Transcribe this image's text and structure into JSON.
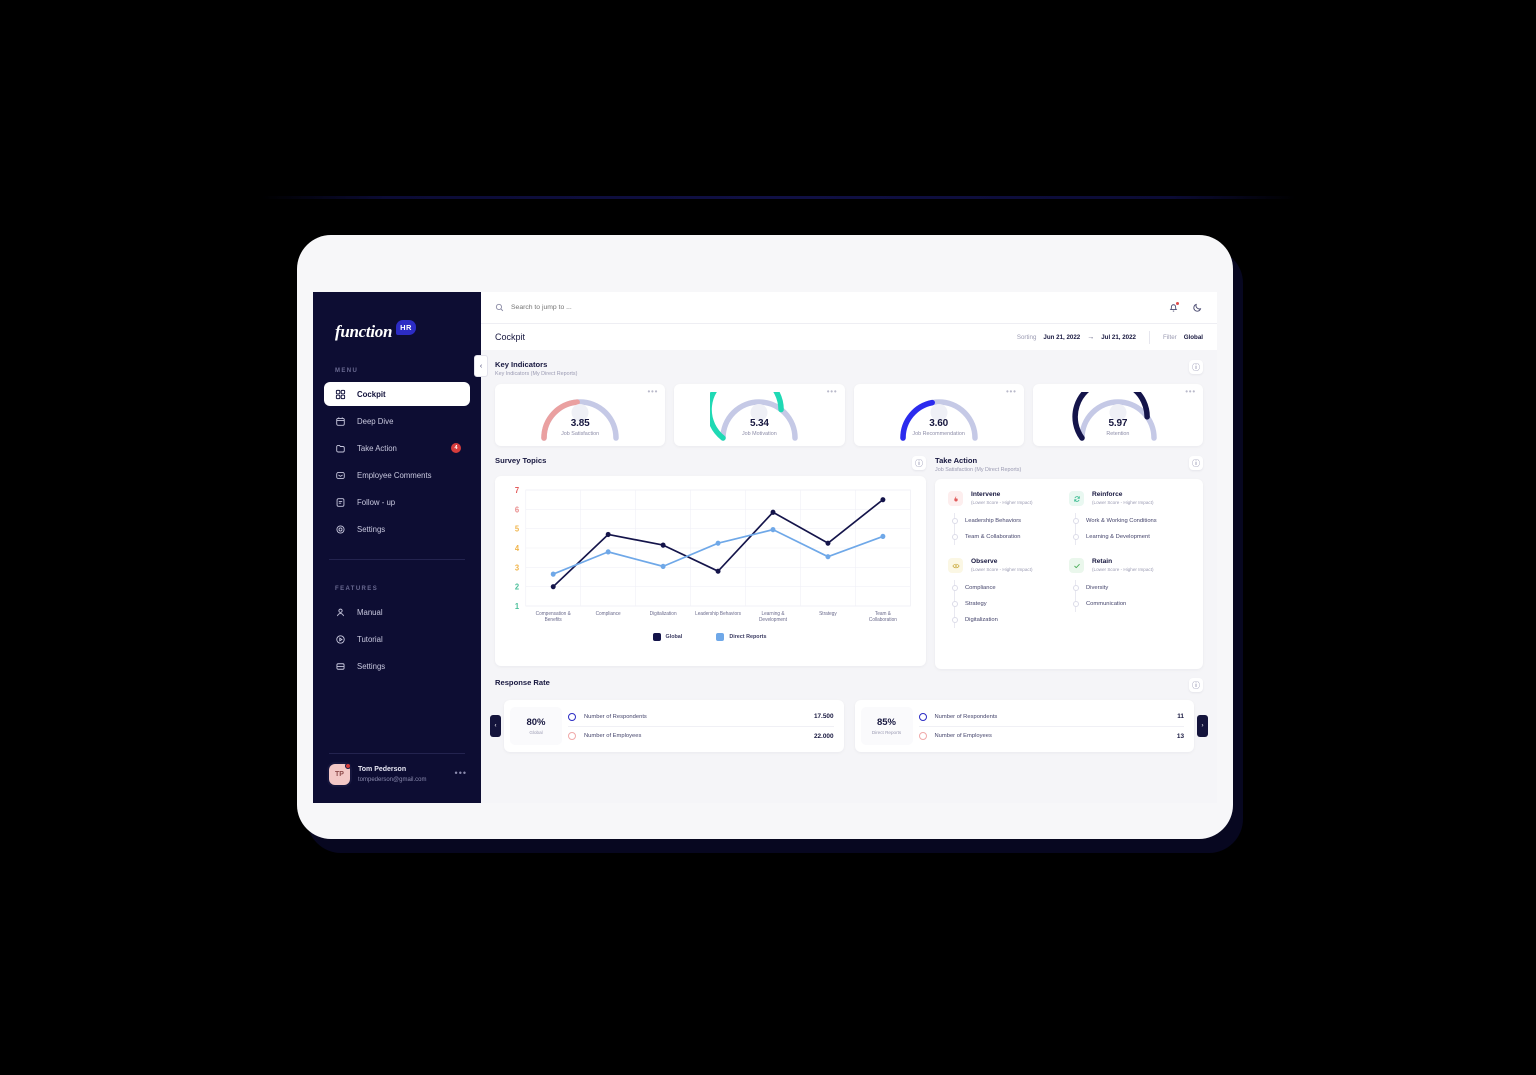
{
  "brand": {
    "name": "function",
    "badge": "HR"
  },
  "sidebar": {
    "menu_label": "MENU",
    "features_label": "FEATURES",
    "menu_items": [
      {
        "label": "Cockpit",
        "icon": "grid-icon",
        "active": true,
        "badge": ""
      },
      {
        "label": "Deep Dive",
        "icon": "calendar-icon",
        "active": false,
        "badge": ""
      },
      {
        "label": "Take Action",
        "icon": "folder-icon",
        "active": false,
        "badge": "4"
      },
      {
        "label": "Employee Comments",
        "icon": "message-icon",
        "active": false,
        "badge": ""
      },
      {
        "label": "Follow - up",
        "icon": "clipboard-icon",
        "active": false,
        "badge": ""
      },
      {
        "label": "Settings",
        "icon": "gear-icon",
        "active": false,
        "badge": ""
      }
    ],
    "feature_items": [
      {
        "label": "Manual",
        "icon": "user-icon"
      },
      {
        "label": "Tutorial",
        "icon": "play-circle-icon"
      },
      {
        "label": "Settings",
        "icon": "sliders-icon"
      }
    ],
    "user": {
      "initials": "TP",
      "name": "Tom Pederson",
      "email": "tompederson@gmail.com",
      "menu": "•••"
    },
    "collapse": "‹"
  },
  "topbar": {
    "search_placeholder": "Search to jump to ...",
    "icons": [
      "bell-icon",
      "moon-icon"
    ]
  },
  "pagebar": {
    "title": "Cockpit",
    "sorting_label": "Sorting",
    "date_from": "Jun 21, 2022",
    "date_arrow": "→",
    "date_to": "Jul 21, 2022",
    "filter_label": "Filter",
    "filter_value": "Global"
  },
  "key_indicators": {
    "title": "Key Indicators",
    "subtitle": "Key Indicators (My Direct Reports)",
    "info": "ⓘ",
    "dots": "•••",
    "cards": [
      {
        "value": "3.85",
        "label": "Job Satisfaction",
        "percent": 0.475,
        "color": "#eaa0a0"
      },
      {
        "value": "5.34",
        "label": "Job Motivation",
        "percent": 0.71,
        "color": "#1fd9b4"
      },
      {
        "value": "3.60",
        "label": "Job Recommendation",
        "percent": 0.44,
        "color": "#2b2bee"
      },
      {
        "value": "5.97",
        "label": "Retention",
        "percent": 0.8,
        "color": "#14144a"
      }
    ],
    "track_color": "#c5c9e6"
  },
  "survey_topics": {
    "title": "Survey Topics",
    "info": "ⓘ"
  },
  "chart_data": {
    "type": "line",
    "title": "Survey Topics",
    "categories": [
      "Compensation & Benefits",
      "Compliance",
      "Digitalization",
      "Leadership Behaviors",
      "Learning & Development",
      "Strategy",
      "Team & Collaboration"
    ],
    "series": [
      {
        "name": "Global",
        "color": "#14144a",
        "values": [
          2.0,
          4.7,
          4.15,
          2.8,
          5.85,
          4.25,
          6.5
        ]
      },
      {
        "name": "Direct Reports",
        "color": "#6fa8e8",
        "values": [
          2.65,
          3.8,
          3.05,
          4.25,
          4.95,
          3.55,
          4.6
        ]
      }
    ],
    "ylim": [
      1,
      7
    ],
    "yticks": [
      1,
      2,
      3,
      4,
      5,
      6,
      7
    ],
    "ytick_colors": {
      "1": "#4bbf9a",
      "2": "#4bbf9a",
      "3": "#f0b44a",
      "4": "#f0b44a",
      "5": "#f0b44a",
      "6": "#e98b8b",
      "7": "#e35b5b"
    },
    "xlabel": "",
    "ylabel": "",
    "grid": true,
    "legend": "bottom-center"
  },
  "take_action": {
    "title": "Take Action",
    "subtitle": "Job Satisfaction (My Direct Reports)",
    "info": "ⓘ",
    "groups": [
      {
        "name": "Intervene",
        "sub": "(Lower Score - Higher Impact)",
        "icon": "fire-icon",
        "icon_bg": "#fdeeee",
        "icon_color": "#e05c5c",
        "items": [
          "Leadership Behaviors",
          "Team & Collaboration"
        ]
      },
      {
        "name": "Reinforce",
        "sub": "(Lower Score - Higher Impact)",
        "icon": "refresh-icon",
        "icon_bg": "#e9f8f1",
        "icon_color": "#2fb88a",
        "items": [
          "Work & Working Conditions",
          "Learning & Development"
        ]
      },
      {
        "name": "Observe",
        "sub": "(Lower Score - Higher Impact)",
        "icon": "eye-icon",
        "icon_bg": "#fbf7e4",
        "icon_color": "#c9a93c",
        "items": [
          "Compliance",
          "Strategy",
          "Digitalization"
        ]
      },
      {
        "name": "Retain",
        "sub": "(Lower Score - Higher Impact)",
        "icon": "check-icon",
        "icon_bg": "#eaf7ec",
        "icon_color": "#4cae5a",
        "items": [
          "Diversity",
          "Communication"
        ]
      }
    ]
  },
  "response_rate": {
    "title": "Response Rate",
    "info": "ⓘ",
    "prev": "‹",
    "next": "›",
    "cards": [
      {
        "percent": "80%",
        "scope": "Global",
        "rows": [
          {
            "label": "Number of Respondents",
            "value": "17.500",
            "ring": "blue"
          },
          {
            "label": "Number of Employees",
            "value": "22.000",
            "ring": "pink"
          }
        ]
      },
      {
        "percent": "85%",
        "scope": "Direct Reports",
        "rows": [
          {
            "label": "Number of Respondents",
            "value": "11",
            "ring": "blue"
          },
          {
            "label": "Number of Employees",
            "value": "13",
            "ring": "pink"
          }
        ]
      }
    ]
  }
}
